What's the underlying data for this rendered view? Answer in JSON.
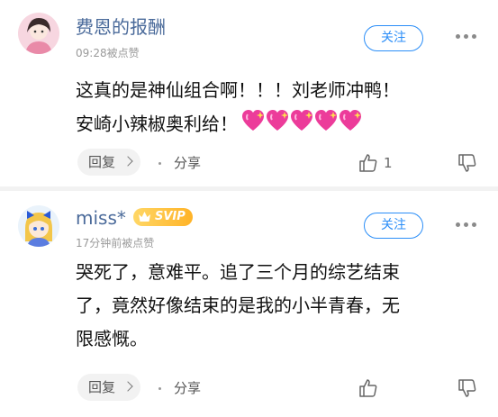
{
  "comments": [
    {
      "username": "费恩的报酬",
      "time": "09:28被点赞",
      "follow_label": "关注",
      "text_line1": "这真的是神仙组合啊！！！刘老师冲鸭！",
      "text_line2": "安崎小辣椒奥利给！",
      "emoji_hearts": 5,
      "reply_label": "回复",
      "share_label": "分享",
      "like_count": "1"
    },
    {
      "username": "miss*",
      "badge": "SVIP",
      "time": "17分钟前被点赞",
      "follow_label": "关注",
      "text_line1": "哭死了，意难平。追了三个月的综艺结束",
      "text_line2": "了，竟然好像结束的是我的小半青春，无",
      "text_line3": "限感慨。",
      "reply_label": "回复",
      "share_label": "分享"
    }
  ],
  "colors": {
    "accent": "#2b8ef8",
    "username": "#4a6a9a",
    "svip": "#ffb327"
  }
}
